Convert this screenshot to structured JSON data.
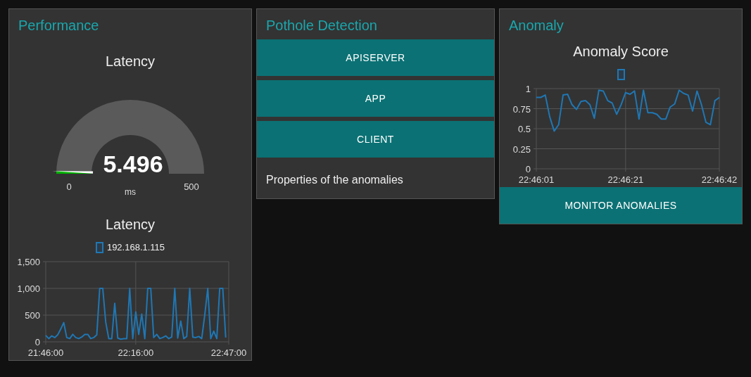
{
  "cards": [
    {
      "title": "Performance",
      "widgets": [
        {
          "kind": "gauge",
          "title": "Latency",
          "value": "5.496",
          "units": "ms",
          "min": "0",
          "max": "500"
        },
        {
          "kind": "chart",
          "chart_data": {
            "type": "line",
            "title": "Latency",
            "categories": [
              "21:46:00",
              null,
              null,
              null,
              null,
              null,
              null,
              null,
              null,
              null,
              null,
              null,
              null,
              null,
              null,
              null,
              null,
              null,
              null,
              null,
              null,
              null,
              null,
              null,
              null,
              null,
              null,
              null,
              null,
              null,
              "22:16:00",
              null,
              null,
              null,
              null,
              null,
              null,
              null,
              null,
              null,
              null,
              null,
              null,
              null,
              null,
              null,
              null,
              null,
              null,
              null,
              null,
              null,
              null,
              null,
              null,
              null,
              null,
              null,
              null,
              null,
              null,
              "22:47:00"
            ],
            "series": [
              {
                "name": "192.168.1.115",
                "color": "#1f77b4",
                "values": [
                  120,
                  60,
                  110,
                  80,
                  130,
                  240,
                  360,
                  80,
                  60,
                  140,
                  80,
                  60,
                  90,
                  140,
                  140,
                  60,
                  80,
                  130,
                  1000,
                  1000,
                  370,
                  60,
                  60,
                  720,
                  70,
                  50,
                  60,
                  60,
                  1000,
                  60,
                  560,
                  140,
                  520,
                  60,
                  1000,
                  1000,
                  80,
                  140,
                  60,
                  80,
                  110,
                  60,
                  90,
                  1000,
                  70,
                  390,
                  60,
                  100,
                  1000,
                  90,
                  80,
                  100,
                  60,
                  500,
                  1000,
                  60,
                  200,
                  60,
                  1000,
                  1000,
                  80,
                  null
                ]
              }
            ],
            "grid": true,
            "ylim": [
              0,
              1500
            ],
            "yticks": [
              {
                "value": 0,
                "label": "0"
              },
              {
                "value": 500,
                "label": "500"
              },
              {
                "value": 1000,
                "label": "1,000"
              },
              {
                "value": 1500,
                "label": "1,500"
              }
            ]
          }
        }
      ]
    },
    {
      "title": "Pothole Detection",
      "widgets": [
        {
          "kind": "button",
          "label": "APISERVER"
        },
        {
          "kind": "button",
          "label": "APP"
        },
        {
          "kind": "button",
          "label": "CLIENT"
        },
        {
          "kind": "text",
          "text": "Properties of the anomalies"
        }
      ]
    },
    {
      "title": "Anomaly",
      "widgets": [
        {
          "kind": "chart",
          "chart_data": {
            "type": "line",
            "title": "Anomaly Score",
            "categories": [
              "22:46:01",
              null,
              null,
              null,
              null,
              null,
              null,
              null,
              null,
              null,
              null,
              null,
              null,
              null,
              null,
              null,
              null,
              null,
              null,
              null,
              "22:46:21",
              null,
              null,
              null,
              null,
              null,
              null,
              null,
              null,
              null,
              null,
              null,
              null,
              null,
              null,
              null,
              null,
              null,
              null,
              null,
              null,
              "22:46:42"
            ],
            "series": [
              {
                "color": "#1f77b4",
                "values": [
                  0.89,
                  0.89,
                  0.92,
                  0.65,
                  0.47,
                  0.55,
                  0.92,
                  0.93,
                  0.8,
                  0.74,
                  0.84,
                  0.85,
                  0.8,
                  0.63,
                  0.98,
                  0.97,
                  0.85,
                  0.82,
                  0.68,
                  0.8,
                  0.95,
                  0.93,
                  0.97,
                  0.62,
                  0.98,
                  0.7,
                  0.7,
                  0.68,
                  0.62,
                  0.62,
                  0.77,
                  0.81,
                  0.98,
                  0.94,
                  0.92,
                  0.72,
                  0.97,
                  0.8,
                  0.58,
                  0.55,
                  0.85,
                  0.89
                ]
              }
            ],
            "grid": true,
            "ylim": [
              0,
              1
            ],
            "yticks": [
              {
                "value": 0,
                "label": "0"
              },
              {
                "value": 0.25,
                "label": "0.25"
              },
              {
                "value": 0.5,
                "label": "0.5"
              },
              {
                "value": 0.75,
                "label": "0.75"
              },
              {
                "value": 1,
                "label": "1"
              }
            ]
          }
        },
        {
          "kind": "button",
          "label": "MONITOR ANOMALIES"
        }
      ]
    }
  ]
}
